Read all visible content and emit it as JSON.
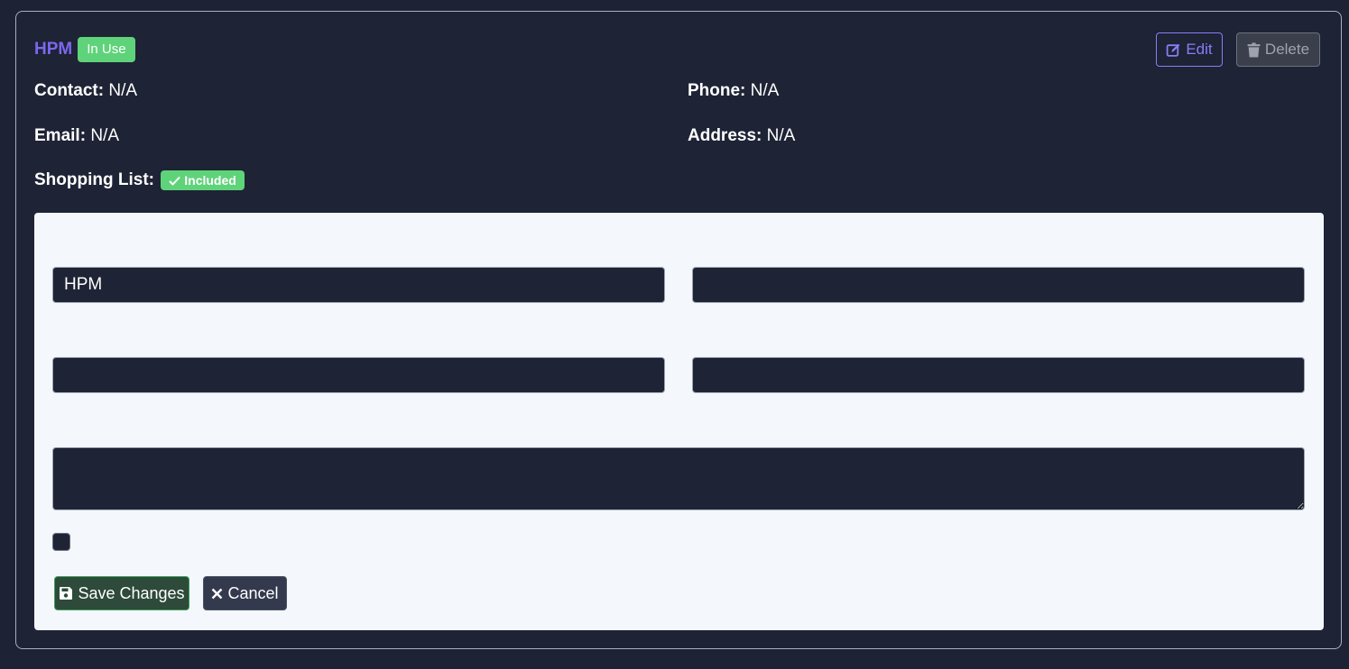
{
  "vendor": {
    "name": "HPM",
    "status_badge": "In Use"
  },
  "actions": {
    "edit_label": "Edit",
    "delete_label": "Delete"
  },
  "details": {
    "contact_label": "Contact:",
    "contact_value": "N/A",
    "phone_label": "Phone:",
    "phone_value": "N/A",
    "email_label": "Email:",
    "email_value": "N/A",
    "address_label": "Address:",
    "address_value": "N/A",
    "shopping_list_label": "Shopping List:",
    "shopping_list_badge": "Included"
  },
  "form": {
    "name_value": "HPM",
    "field2_value": "",
    "field3_value": "",
    "field4_value": "",
    "notes_value": "",
    "checkbox_checked": false,
    "save_label": "Save Changes",
    "cancel_label": "Cancel"
  },
  "colors": {
    "accent": "#7b68ee",
    "success": "#5fd37a",
    "background": "#1e2335",
    "panel": "#f4f7fb"
  }
}
